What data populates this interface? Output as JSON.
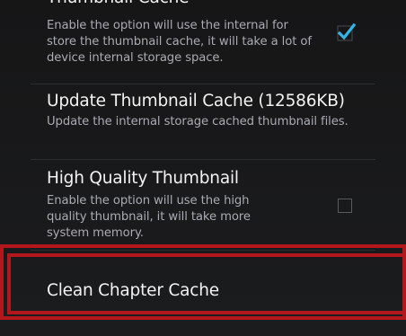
{
  "settings": {
    "items": [
      {
        "title": "Thumbnail Cache",
        "summary": "Enable the option will use the internal for store the thumbnail cache, it will take a lot of device internal storage space.",
        "checked": true
      },
      {
        "title": "Update Thumbnail Cache (12586KB)",
        "summary": "Update the internal storage cached thumbnail files."
      },
      {
        "title": "High Quality Thumbnail",
        "summary": "Enable the option will use the high quality thumbnail, it will take more system memory.",
        "checked": false
      },
      {
        "title": "Clean Chapter Cache"
      }
    ]
  },
  "colors": {
    "background": "#161617",
    "accent": "#33b5e5",
    "highlight": "#b3171b",
    "title_text": "#f2f2f2",
    "summary_text": "#a9abb0"
  }
}
